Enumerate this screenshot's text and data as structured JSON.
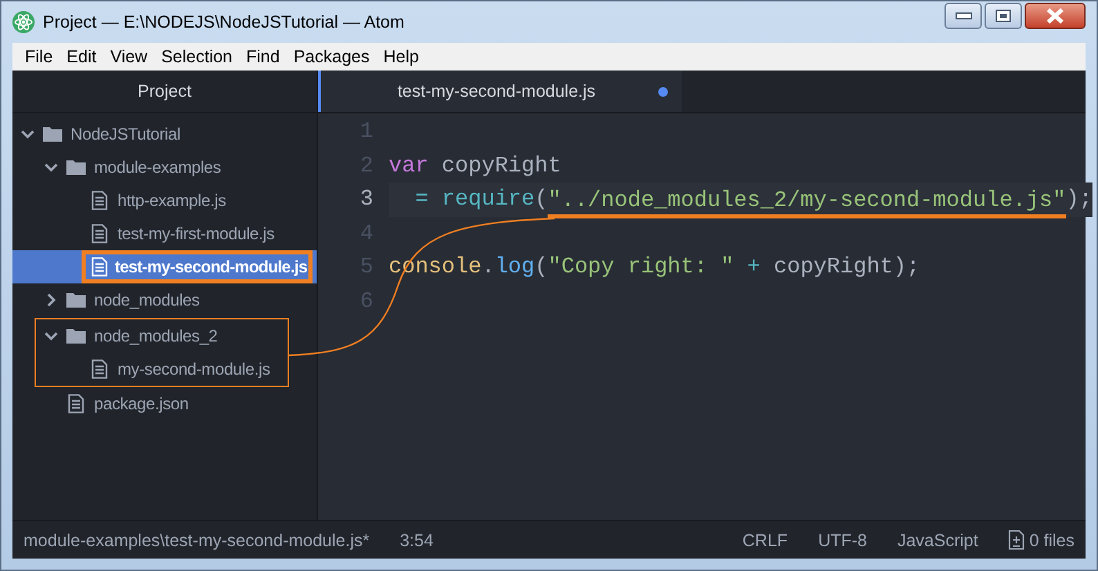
{
  "window": {
    "title": "Project — E:\\NODEJS\\NodeJSTutorial — Atom",
    "controls": [
      {
        "kind": "minimize"
      },
      {
        "kind": "maximize"
      },
      {
        "kind": "close"
      }
    ]
  },
  "menu": [
    "File",
    "Edit",
    "View",
    "Selection",
    "Find",
    "Packages",
    "Help"
  ],
  "sidebar": {
    "title": "Project",
    "tree": [
      {
        "name": "NodeJSTutorial",
        "kind": "folder",
        "expanded": true,
        "selected": false,
        "boxed": false,
        "children": [
          {
            "name": "module-examples",
            "kind": "folder",
            "expanded": true,
            "selected": false,
            "boxed": false,
            "children": [
              {
                "name": "http-example.js",
                "kind": "file",
                "selected": false,
                "boxed": false
              },
              {
                "name": "test-my-first-module.js",
                "kind": "file",
                "selected": false,
                "boxed": false
              },
              {
                "name": "test-my-second-module.js",
                "kind": "file",
                "selected": true,
                "boxed": true
              }
            ]
          },
          {
            "name": "node_modules",
            "kind": "folder",
            "expanded": false,
            "selected": false,
            "boxed": false
          },
          {
            "name": "node_modules_2",
            "kind": "folder",
            "expanded": true,
            "selected": false,
            "boxed": true,
            "children": [
              {
                "name": "my-second-module.js",
                "kind": "file",
                "selected": false,
                "boxed": false
              }
            ]
          },
          {
            "name": "package.json",
            "kind": "file",
            "selected": false,
            "boxed": false
          }
        ]
      }
    ]
  },
  "tabs": [
    {
      "label": "test-my-second-module.js",
      "selected": true,
      "modified": true
    }
  ],
  "editor": {
    "lines": [
      {
        "number": "1",
        "current": false
      },
      {
        "number": "2",
        "current": false,
        "tokens": [
          {
            "kind": "keyword",
            "text": "var"
          },
          {
            "kind": "plain",
            "text": " copyRight"
          }
        ]
      },
      {
        "number": "3",
        "current": true,
        "tokens": [
          {
            "kind": "operator",
            "text": "  = "
          },
          {
            "kind": "function",
            "text": "require"
          },
          {
            "kind": "plain",
            "text": "("
          },
          {
            "kind": "string",
            "text": "\"../node_modules_2/my-second-module.js\"",
            "underlined": true
          },
          {
            "kind": "plain",
            "text": ");"
          }
        ]
      },
      {
        "number": "4",
        "current": false
      },
      {
        "number": "5",
        "current": false,
        "tokens": [
          {
            "kind": "object",
            "text": "console"
          },
          {
            "kind": "plain",
            "text": "."
          },
          {
            "kind": "method",
            "text": "log"
          },
          {
            "kind": "plain",
            "text": "("
          },
          {
            "kind": "string",
            "text": "\"Copy right: \""
          },
          {
            "kind": "operator",
            "text": " + "
          },
          {
            "kind": "plain",
            "text": "copyRight);"
          }
        ]
      },
      {
        "number": "6",
        "current": false
      }
    ]
  },
  "status_bar": {
    "path": "module-examples\\test-my-second-module.js*",
    "cursor": "3:54",
    "line_ending": "CRLF",
    "encoding": "UTF-8",
    "grammar": "JavaScript",
    "files": "0 files"
  }
}
